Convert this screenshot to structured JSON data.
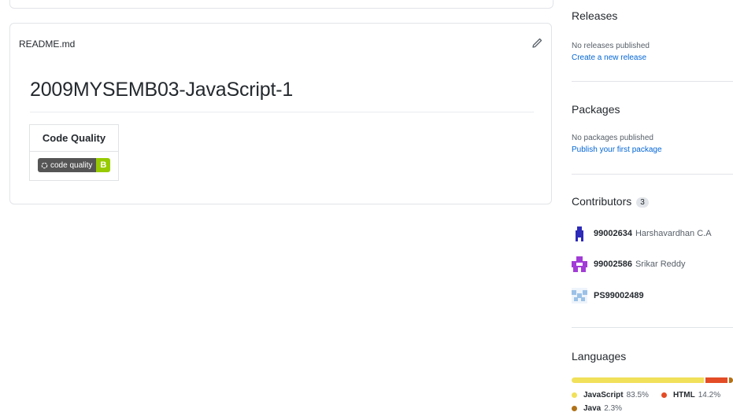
{
  "readme": {
    "filename": "README.md",
    "title": "2009MYSEMB03-JavaScript-1",
    "table_header": "Code Quality",
    "badge_label": "code quality",
    "badge_grade": "B"
  },
  "sidebar": {
    "releases": {
      "heading": "Releases",
      "status": "No releases published",
      "link": "Create a new release"
    },
    "packages": {
      "heading": "Packages",
      "status": "No packages published",
      "link": "Publish your first package"
    },
    "contributors": {
      "heading": "Contributors",
      "count": "3",
      "items": [
        {
          "login": "99002634",
          "name": "Harshavardhan C.A"
        },
        {
          "login": "99002586",
          "name": "Srikar Reddy"
        },
        {
          "login": "PS99002489",
          "name": ""
        }
      ]
    },
    "languages": {
      "heading": "Languages",
      "items": [
        {
          "name": "JavaScript",
          "percent": "83.5%",
          "color": "#f1e05a",
          "value": 83.5
        },
        {
          "name": "HTML",
          "percent": "14.2%",
          "color": "#e34c26",
          "value": 14.2
        },
        {
          "name": "Java",
          "percent": "2.3%",
          "color": "#b07219",
          "value": 2.3
        }
      ]
    }
  }
}
